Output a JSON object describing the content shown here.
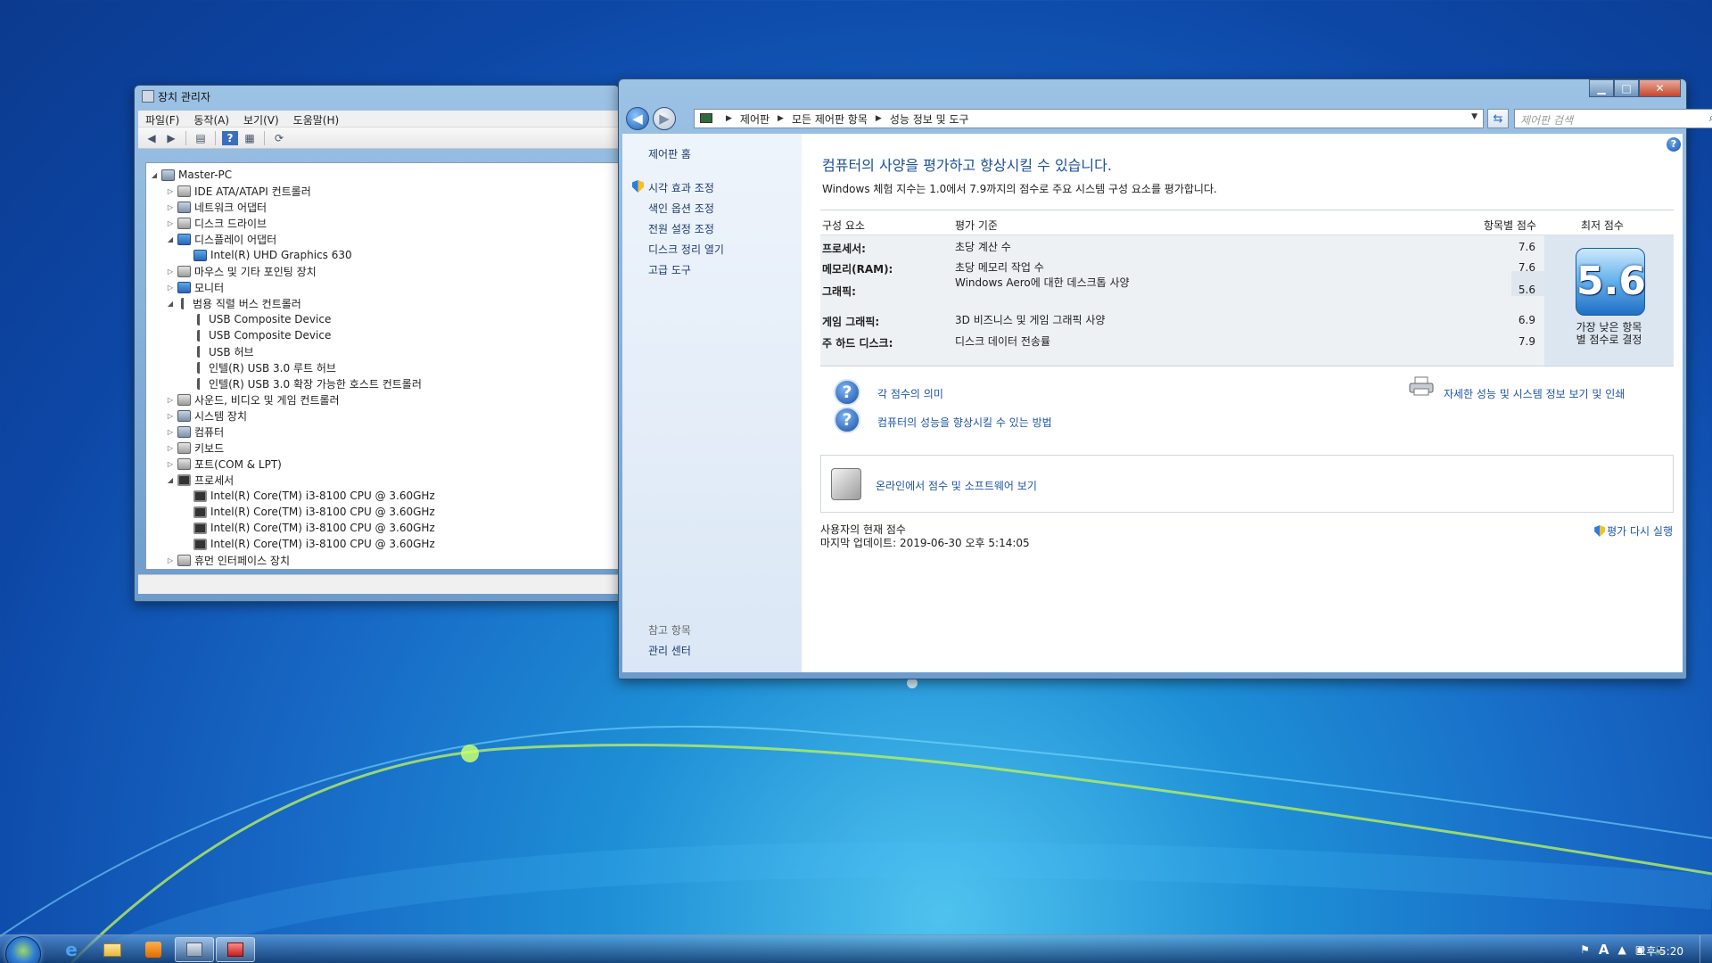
{
  "device_manager": {
    "title": "장치 관리자",
    "menu": [
      "파일(F)",
      "동작(A)",
      "보기(V)",
      "도움말(H)"
    ],
    "tree": [
      {
        "label": "Master-PC",
        "level": 0,
        "expander": "◢",
        "icon": "computer-icon"
      },
      {
        "label": "IDE ATA/ATAPI 컨트롤러",
        "level": 1,
        "expander": "▷",
        "icon": "controller-icon"
      },
      {
        "label": "네트워크 어댑터",
        "level": 1,
        "expander": "▷",
        "icon": "network-icon"
      },
      {
        "label": "디스크 드라이브",
        "level": 1,
        "expander": "▷",
        "icon": "disk-icon"
      },
      {
        "label": "디스플레이 어댑터",
        "level": 1,
        "expander": "◢",
        "icon": "display-icon"
      },
      {
        "label": "Intel(R) UHD Graphics 630",
        "level": 2,
        "expander": "",
        "icon": "display-icon"
      },
      {
        "label": "마우스 및 기타 포인팅 장치",
        "level": 1,
        "expander": "▷",
        "icon": "mouse-icon"
      },
      {
        "label": "모니터",
        "level": 1,
        "expander": "▷",
        "icon": "monitor-icon"
      },
      {
        "label": "범용 직렬 버스 컨트롤러",
        "level": 1,
        "expander": "◢",
        "icon": "usb-icon"
      },
      {
        "label": "USB Composite Device",
        "level": 2,
        "expander": "",
        "icon": "usb-icon"
      },
      {
        "label": "USB Composite Device",
        "level": 2,
        "expander": "",
        "icon": "usb-icon"
      },
      {
        "label": "USB 허브",
        "level": 2,
        "expander": "",
        "icon": "usb-icon"
      },
      {
        "label": "인텔(R) USB 3.0 루트 허브",
        "level": 2,
        "expander": "",
        "icon": "usb-icon"
      },
      {
        "label": "인텔(R) USB 3.0 확장 가능한 호스트 컨트롤러",
        "level": 2,
        "expander": "",
        "icon": "usb-icon"
      },
      {
        "label": "사운드, 비디오 및 게임 컨트롤러",
        "level": 1,
        "expander": "▷",
        "icon": "sound-icon"
      },
      {
        "label": "시스템 장치",
        "level": 1,
        "expander": "▷",
        "icon": "system-icon"
      },
      {
        "label": "컴퓨터",
        "level": 1,
        "expander": "▷",
        "icon": "computer-icon"
      },
      {
        "label": "키보드",
        "level": 1,
        "expander": "▷",
        "icon": "keyboard-icon"
      },
      {
        "label": "포트(COM & LPT)",
        "level": 1,
        "expander": "▷",
        "icon": "port-icon"
      },
      {
        "label": "프로세서",
        "level": 1,
        "expander": "◢",
        "icon": "processor-icon"
      },
      {
        "label": "Intel(R) Core(TM) i3-8100 CPU @ 3.60GHz",
        "level": 2,
        "expander": "",
        "icon": "processor-icon"
      },
      {
        "label": "Intel(R) Core(TM) i3-8100 CPU @ 3.60GHz",
        "level": 2,
        "expander": "",
        "icon": "processor-icon"
      },
      {
        "label": "Intel(R) Core(TM) i3-8100 CPU @ 3.60GHz",
        "level": 2,
        "expander": "",
        "icon": "processor-icon"
      },
      {
        "label": "Intel(R) Core(TM) i3-8100 CPU @ 3.60GHz",
        "level": 2,
        "expander": "",
        "icon": "processor-icon"
      },
      {
        "label": "휴먼 인터페이스 장치",
        "level": 1,
        "expander": "▷",
        "icon": "hid-icon"
      }
    ]
  },
  "control_panel": {
    "breadcrumb": [
      "제어판",
      "모든 제어판 항목",
      "성능 정보 및 도구"
    ],
    "search_placeholder": "제어판 검색",
    "sidebar": {
      "home": "제어판 홈",
      "links": [
        "시각 효과 조정",
        "색인 옵션 조정",
        "전원 설정 조정",
        "디스크 정리 열기",
        "고급 도구"
      ],
      "see_also_header": "참고 항목",
      "see_also": [
        "관리 센터"
      ]
    },
    "heading": "컴퓨터의 사양을 평가하고 향상시킬 수 있습니다.",
    "description": "Windows 체험 지수는 1.0에서 7.9까지의 점수로 주요 시스템 구성 요소를 평가합니다.",
    "table_headers": {
      "component": "구성 요소",
      "criteria": "평가 기준",
      "subscore": "항목별 점수",
      "base": "최저 점수"
    },
    "rows": [
      {
        "component": "프로세서:",
        "criteria": "초당 계산 수",
        "score": "7.6"
      },
      {
        "component": "메모리(RAM):",
        "criteria": "초당 메모리 작업 수",
        "score": "7.6"
      },
      {
        "component": "그래픽:",
        "criteria": "Windows Aero에 대한 데스크톱 사양",
        "score": "5.6"
      },
      {
        "component": "게임 그래픽:",
        "criteria": "3D 비즈니스 및 게임 그래픽 사양",
        "score": "6.9"
      },
      {
        "component": "주 하드 디스크:",
        "criteria": "디스크 데이터 전송률",
        "score": "7.9"
      }
    ],
    "base_score": "5.6",
    "base_caption_1": "가장 낮은 항목",
    "base_caption_2": "별 점수로 결정",
    "links": {
      "meaning": "각 점수의 의미",
      "improve": "컴퓨터의 성능을 향상시킬 수 있는 방법",
      "details": "자세한 성능 및 시스템 정보 보기 및 인쇄",
      "online": "온라인에서 점수 및 소프트웨어 보기",
      "rerun": "평가 다시 실행"
    },
    "current_score_label": "사용자의 현재 점수",
    "last_update": "마지막 업데이트: 2019-06-30 오후 5:14:05"
  },
  "taskbar": {
    "clock": "오후 5:20",
    "ime": "A"
  }
}
